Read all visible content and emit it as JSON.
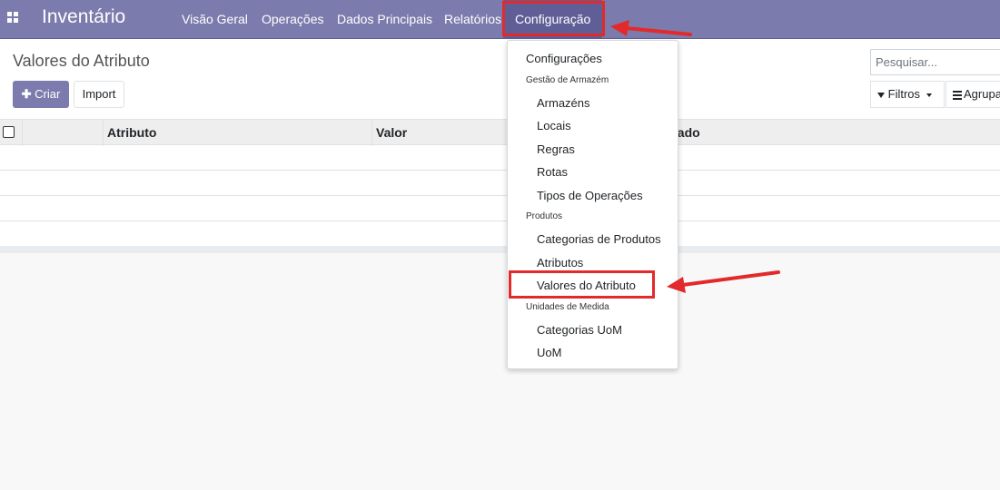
{
  "navbar": {
    "app_name": "Inventário",
    "menu": [
      "Visão Geral",
      "Operações",
      "Dados Principais",
      "Relatórios",
      "Configuração"
    ]
  },
  "control_panel": {
    "breadcrumb": "Valores do Atributo",
    "create_label": "Criar",
    "import_label": "Import",
    "search_placeholder": "Pesquisar...",
    "filters_label": "Filtros",
    "group_label": "Agrupar"
  },
  "table": {
    "columns": [
      "Atributo",
      "Valor",
      "Estado"
    ]
  },
  "dropdown": {
    "top_item": "Configurações",
    "sections": [
      {
        "header": "Gestão de Armazém",
        "items": [
          "Armazéns",
          "Locais",
          "Regras",
          "Rotas",
          "Tipos de Operações"
        ]
      },
      {
        "header": "Produtos",
        "items": [
          "Categorias de Produtos",
          "Atributos",
          "Valores do Atributo"
        ]
      },
      {
        "header": "Unidades de Medida",
        "items": [
          "Categorias UoM",
          "UoM"
        ]
      }
    ]
  },
  "colors": {
    "navbar": "#7c7bad",
    "navbar_active": "#5f5e97",
    "annotation_red": "#e32a2a"
  }
}
